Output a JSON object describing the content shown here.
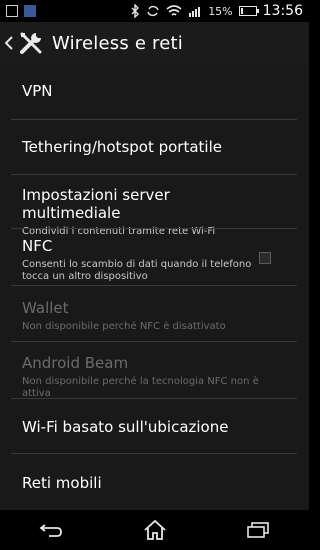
{
  "status_bar": {
    "battery_percent": "15%",
    "time": "13:56",
    "icons": [
      "image-icon",
      "facebook-icon",
      "bluetooth-icon",
      "sync-icon",
      "wifi-icon",
      "signal-icon"
    ],
    "battery_level": 0.15
  },
  "action_bar": {
    "title": "Wireless e reti",
    "back_icon": "chevron-left-icon",
    "app_icon": "tools-icon"
  },
  "items": [
    {
      "id": "vpn",
      "title": "VPN",
      "subtitle": "",
      "enabled": true
    },
    {
      "id": "tethering",
      "title": "Tethering/hotspot portatile",
      "subtitle": "",
      "enabled": true
    },
    {
      "id": "media-server",
      "title": "Impostazioni server multimediale",
      "subtitle": "Condividi i contenuti tramite rete Wi-Fi",
      "enabled": true
    },
    {
      "id": "nfc",
      "title": "NFC",
      "subtitle": "Consenti lo scambio di dati quando il telefono tocca un altro dispositivo",
      "enabled": true,
      "checked": false
    },
    {
      "id": "wallet",
      "title": "Wallet",
      "subtitle": "Non disponibile perché NFC è disattivato",
      "enabled": false
    },
    {
      "id": "android-beam",
      "title": "Android Beam",
      "subtitle": "Non disponibile perché la tecnologia NFC non è attiva",
      "enabled": false
    },
    {
      "id": "wifi-location",
      "title": "Wi-Fi basato sull'ubicazione",
      "subtitle": "",
      "enabled": true
    },
    {
      "id": "mobile-networks",
      "title": "Reti mobili",
      "subtitle": "",
      "enabled": true
    }
  ],
  "nav_bar": {
    "icons": [
      "back-icon",
      "home-icon",
      "recent-apps-icon"
    ]
  }
}
